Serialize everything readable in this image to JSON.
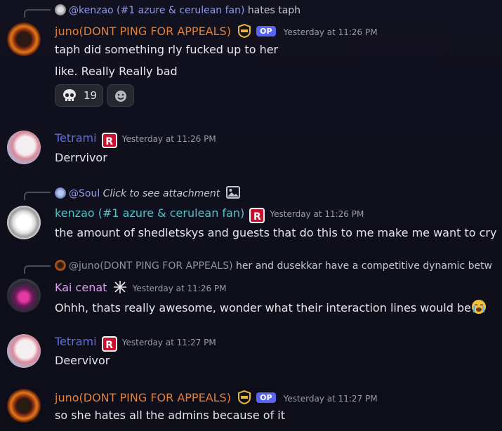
{
  "colors": {
    "juno": "#e0803a",
    "tetrami": "#5b6ee8",
    "kenzao": "#4fc3c8",
    "kai": "#d8a0ea"
  },
  "messages": [
    {
      "reply": {
        "mention": "@kenzao (#1 azure & cerulean fan)",
        "text": "hates taph"
      },
      "author": "juno(DONT PING FOR APPEALS)",
      "badge": "OP",
      "timestamp": "Yesterday at 11:26 PM",
      "lines": [
        "taph did something rly fucked up to her",
        "like. Really Really bad"
      ],
      "reaction": {
        "emoji": "skull-icon",
        "count": "19"
      }
    },
    {
      "author": "Tetrami",
      "timestamp": "Yesterday at 11:26 PM",
      "lines": [
        "Derrvivor"
      ]
    },
    {
      "reply": {
        "mention": "@Soul",
        "text": "Click to see attachment"
      },
      "author": "kenzao (#1 azure & cerulean fan)",
      "timestamp": "Yesterday at 11:26 PM",
      "lines": [
        "the amount of shedletskys and guests that do this to me make me want to cry"
      ]
    },
    {
      "reply": {
        "mention": "@juno(DONT PING FOR APPEALS)",
        "text": "her and dusekkar have a competitive dynamic betw"
      },
      "author": "Kai cenat",
      "timestamp": "Yesterday at 11:26 PM",
      "lines": [
        "Ohhh, thats really awesome, wonder what their interaction lines would be"
      ]
    },
    {
      "author": "Tetrami",
      "timestamp": "Yesterday at 11:27 PM",
      "lines": [
        "Deervivor"
      ]
    },
    {
      "author": "juno(DONT PING FOR APPEALS)",
      "badge": "OP",
      "timestamp": "Yesterday at 11:27 PM",
      "lines": [
        "so she hates all the admins because of it"
      ]
    }
  ]
}
